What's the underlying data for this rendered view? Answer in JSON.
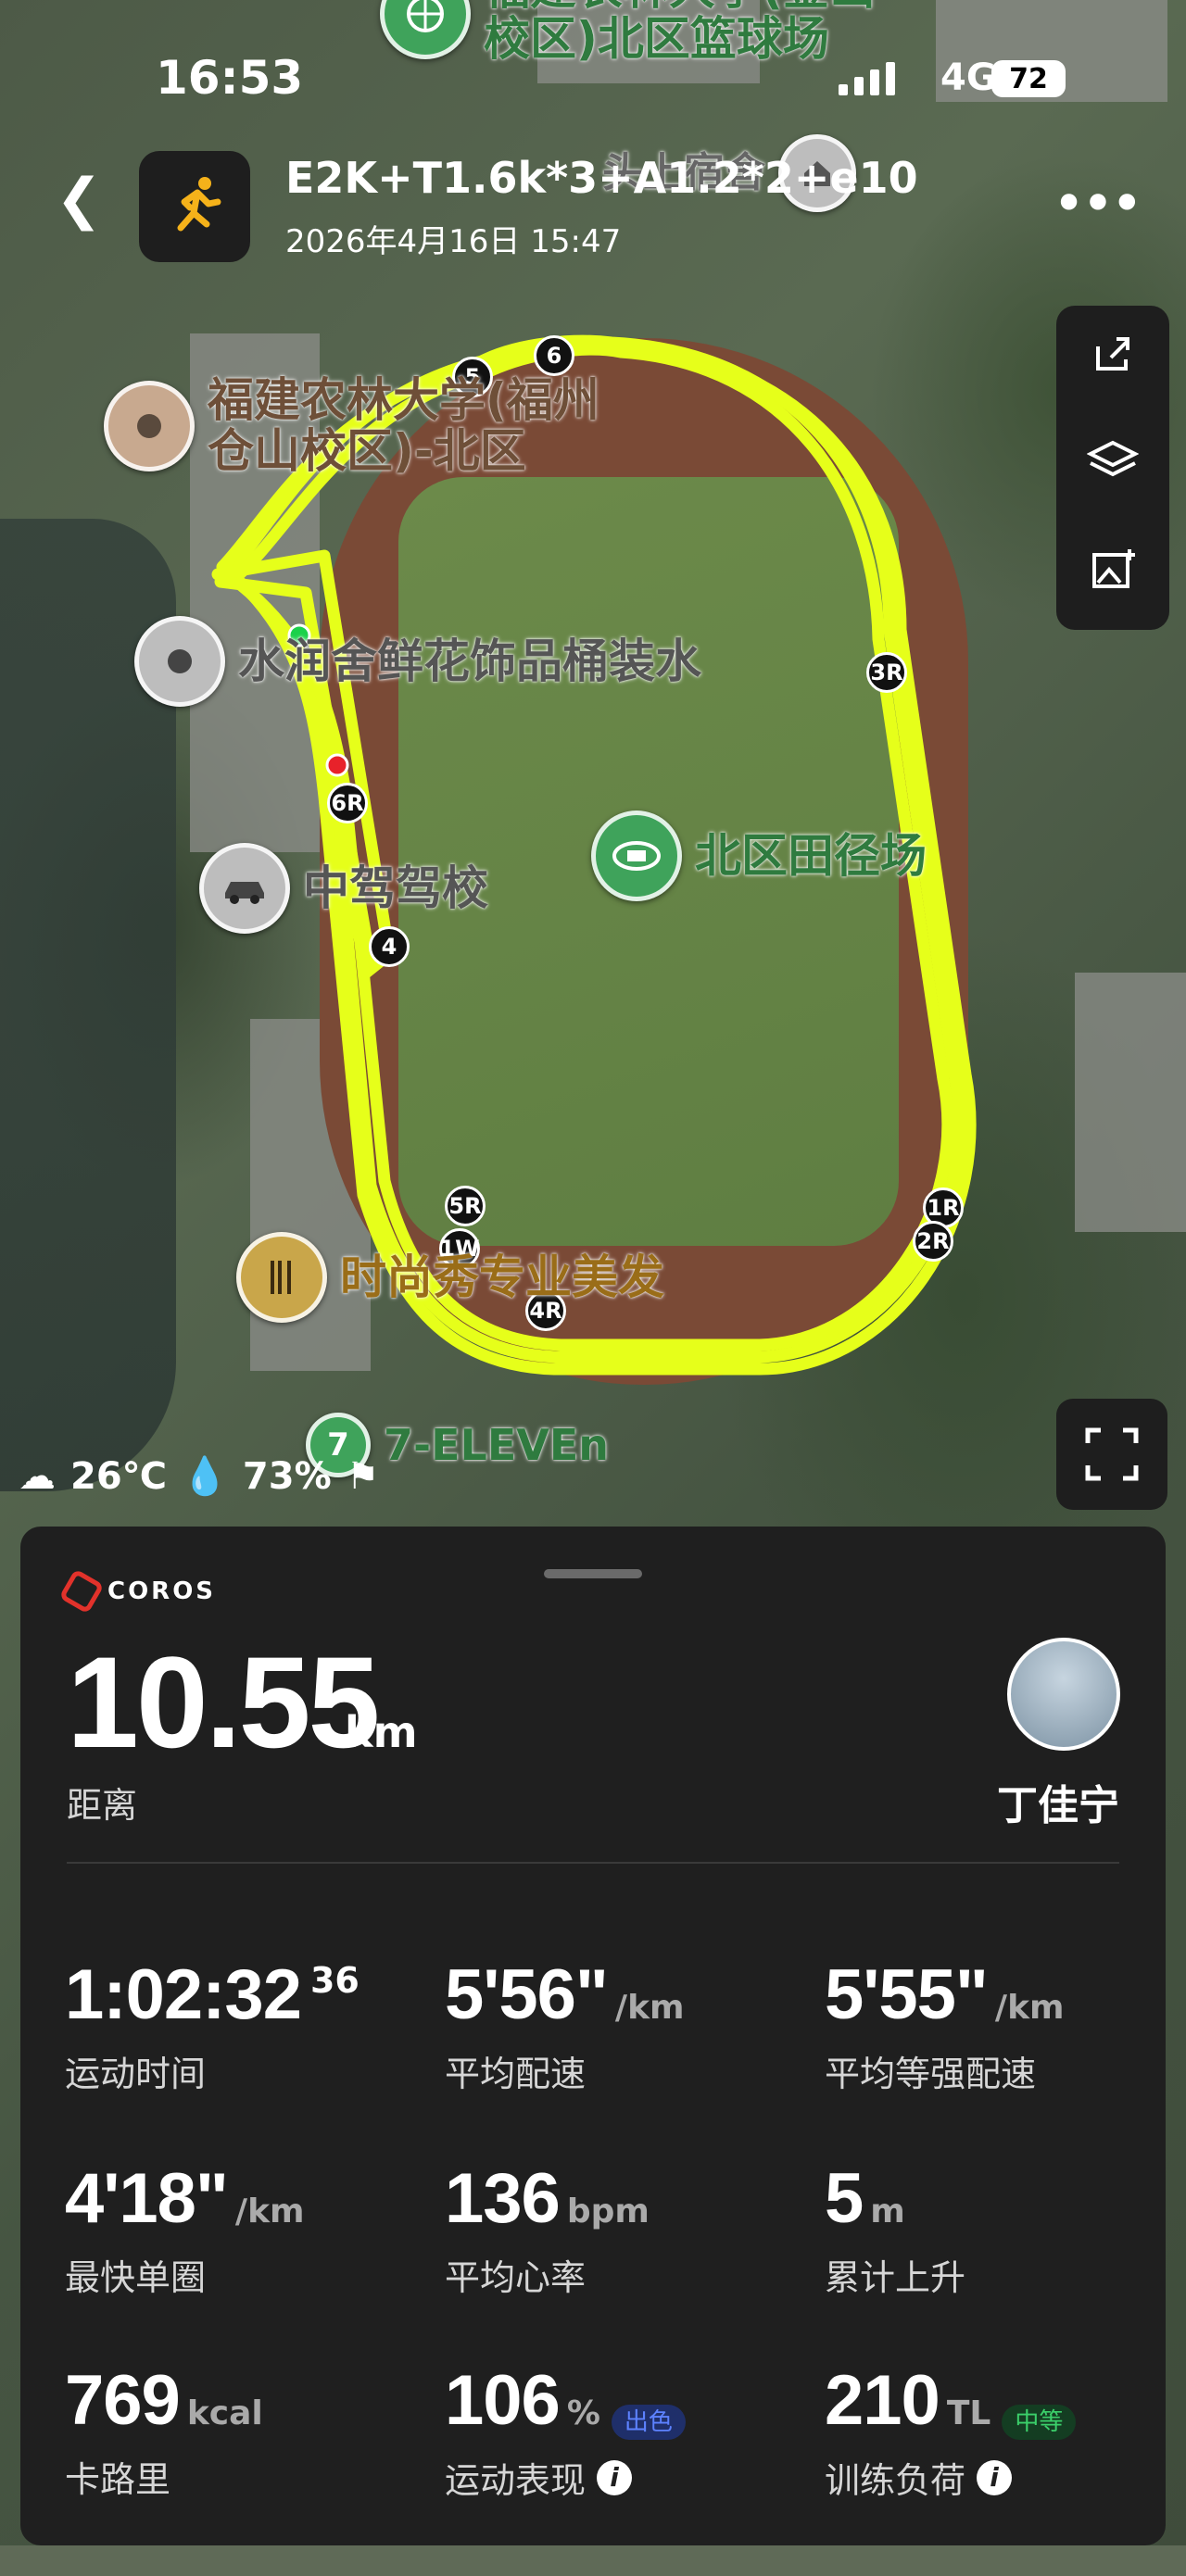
{
  "status_bar": {
    "time": "16:53",
    "network": "4G",
    "battery": "72"
  },
  "header": {
    "title": "E2K+T1.6k*3+A1.2*2+e10",
    "datetime": "2026年4月16日 15:47",
    "activity_icon": "running-icon"
  },
  "map": {
    "pois": [
      {
        "name": "福建农林大学(金山\n校区)北区篮球场",
        "icon": "basketball-icon"
      },
      {
        "name": "头上宿舍",
        "icon": "home-icon"
      },
      {
        "name": "福建农林大学(福州\n仓山校区)-北区",
        "icon": "location-icon"
      },
      {
        "name": "水润舍鲜花饰品桶装水",
        "icon": "location-icon"
      },
      {
        "name": "北区田径场",
        "icon": "stadium-icon"
      },
      {
        "name": "中驾驾校",
        "icon": "car-icon"
      },
      {
        "name": "时尚秀专业美发",
        "icon": "barber-icon"
      },
      {
        "name": "7-ELEVEn",
        "icon": "store-icon"
      }
    ],
    "lap_markers": [
      "5",
      "6",
      "3R",
      "6R",
      "4",
      "5R",
      "1W",
      "4R",
      "1R",
      "2R"
    ],
    "side_tools": [
      "share-icon",
      "layers-icon",
      "add-photo-icon"
    ],
    "weather": {
      "temperature": "26℃",
      "humidity": "73%"
    }
  },
  "summary": {
    "brand": "COROS",
    "distance": "10.55",
    "distance_unit": "km",
    "distance_label": "距离",
    "user_name": "丁佳宁",
    "stats": [
      {
        "value": "1:02:32",
        "sup": "36",
        "unit": "",
        "label": "运动时间"
      },
      {
        "value": "5'56\"",
        "unit": "/km",
        "label": "平均配速"
      },
      {
        "value": "5'55\"",
        "unit": "/km",
        "label": "平均等强配速"
      },
      {
        "value": "4'18\"",
        "unit": "/km",
        "label": "最快单圈"
      },
      {
        "value": "136",
        "unit": "bpm",
        "label": "平均心率"
      },
      {
        "value": "5",
        "unit": "m",
        "label": "累计上升"
      },
      {
        "value": "769",
        "unit": "kcal",
        "label": "卡路里"
      },
      {
        "value": "106",
        "unit": "%",
        "badge": "出色",
        "label": "运动表现"
      },
      {
        "value": "210",
        "unit": "TL",
        "badge": "中等",
        "label": "训练负荷"
      }
    ]
  },
  "colors": {
    "route": "#e6ff1a",
    "panel": "#1f1f1f",
    "brand_red": "#e2322b",
    "badge_blue": "#5d82ff",
    "badge_green": "#3bcf6a"
  }
}
